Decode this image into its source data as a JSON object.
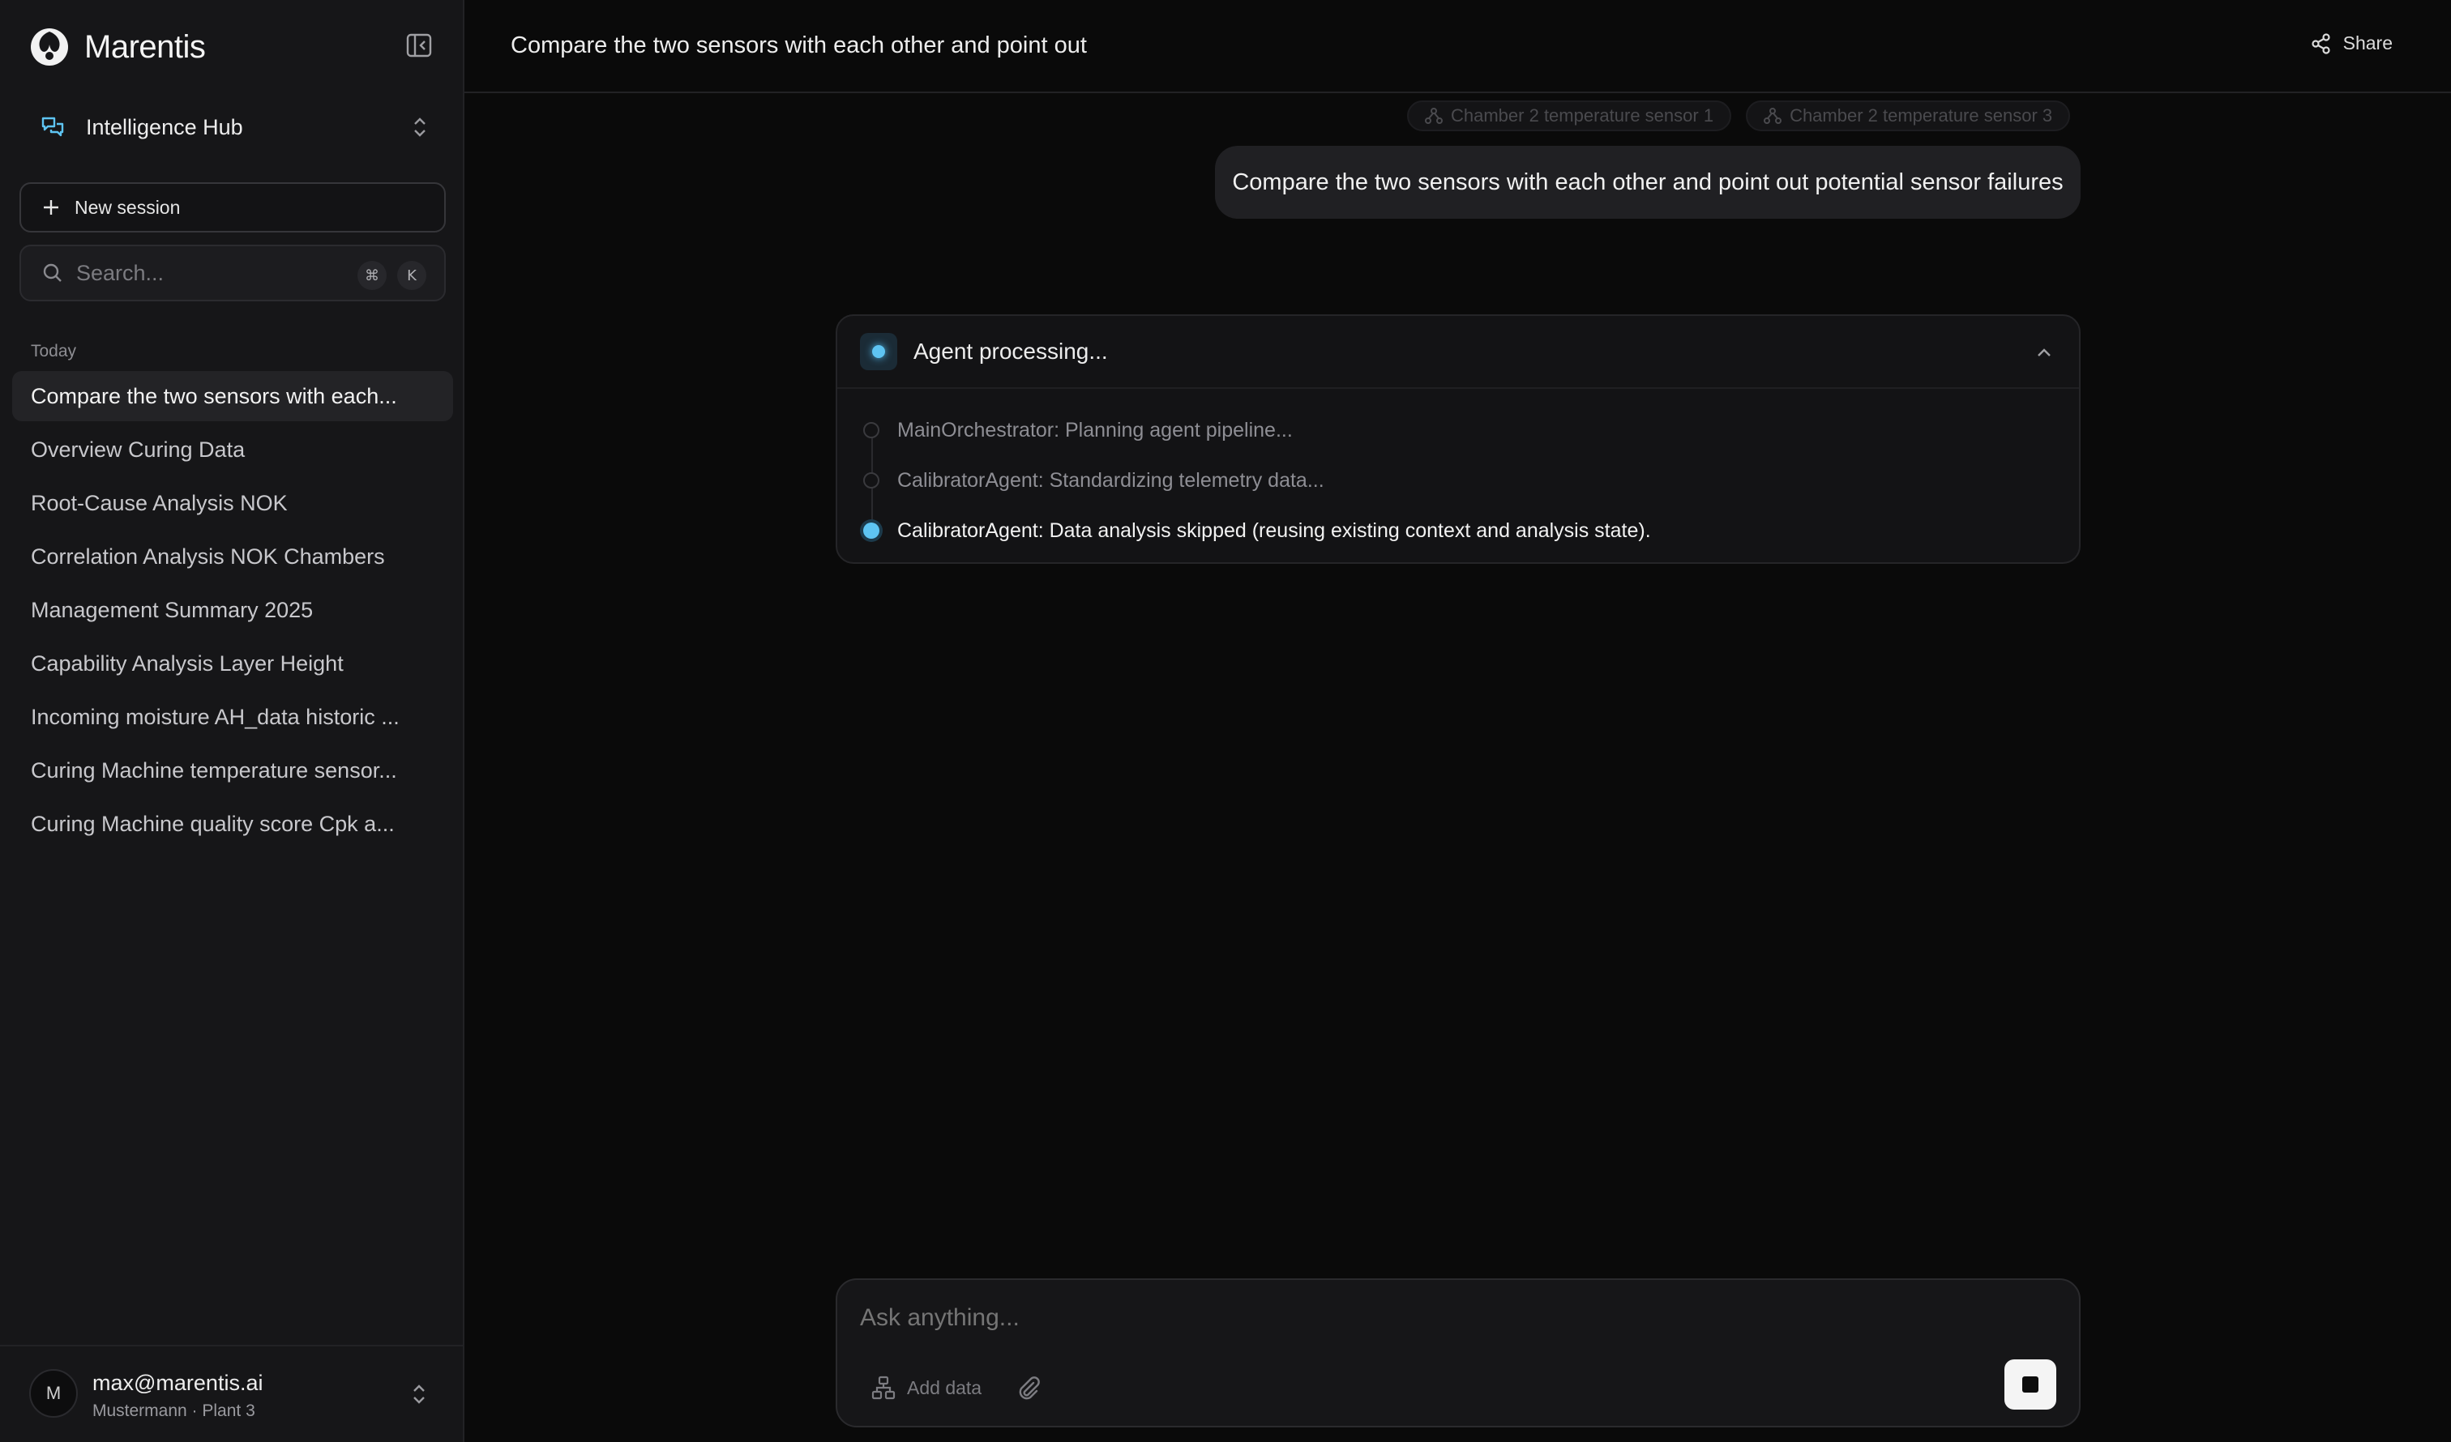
{
  "sidebar": {
    "brand": "Marentis",
    "workspace": "Intelligence Hub",
    "new_session": "New session",
    "search_placeholder": "Search...",
    "kbd": [
      "⌘",
      "K"
    ],
    "section": "Today",
    "sessions": [
      "Compare the two sensors with each...",
      "Overview Curing Data",
      "Root-Cause Analysis NOK",
      "Correlation Analysis NOK Chambers",
      "Management Summary 2025",
      "Capability Analysis Layer Height",
      "Incoming moisture AH_data historic ...",
      "Curing Machine temperature sensor...",
      "Curing Machine quality score Cpk a..."
    ],
    "user": {
      "initial": "M",
      "email": "max@marentis.ai",
      "org": "Mustermann · Plant 3"
    }
  },
  "header": {
    "title": "Compare the two sensors with each other and point out",
    "share": "Share"
  },
  "chat": {
    "chips": [
      "Chamber 2 temperature sensor 1",
      "Chamber 2 temperature sensor 3"
    ],
    "user_message": "Compare the two sensors with each other and point out potential sensor failures",
    "agent": {
      "title": "Agent processing...",
      "steps": [
        "MainOrchestrator: Planning agent pipeline...",
        "CalibratorAgent: Standardizing telemetry data...",
        "CalibratorAgent: Data analysis skipped (reusing existing context and analysis state)."
      ]
    }
  },
  "composer": {
    "placeholder": "Ask anything...",
    "add_data": "Add data"
  },
  "colors": {
    "accent": "#5ec4f2",
    "background": "#0a0a0a",
    "sidebar": "#161618"
  }
}
